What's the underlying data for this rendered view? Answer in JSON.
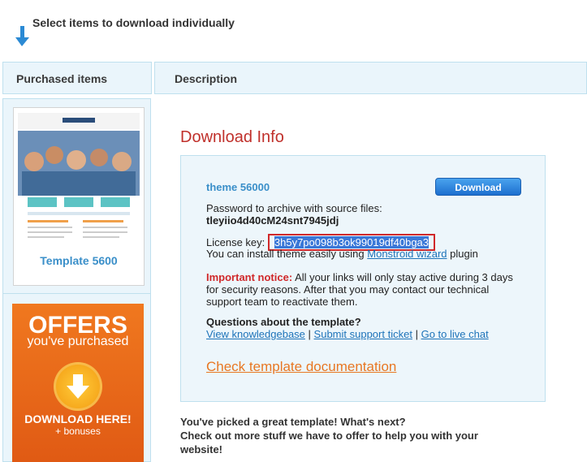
{
  "top": {
    "label": "Select items to download individually"
  },
  "columns": {
    "purchased": "Purchased items",
    "description": "Description"
  },
  "item": {
    "caption": "Template 5600"
  },
  "offers": {
    "title": "OFFERS",
    "subtitle": "you've purchased",
    "download": "DOWNLOAD HERE!",
    "bonus": "+ bonuses"
  },
  "download": {
    "title": "Download Info",
    "theme_name": "theme 56000",
    "button": "Download",
    "password_label": "Password to archive with source files:",
    "password_value": "tleyiio4d40cM24snt7945jdj",
    "license_label": "License key:",
    "license_value": "3h5y7po098b3ok99019df40bga3",
    "install_prefix": "You can install theme easily using",
    "install_link": "Monstroid wizard",
    "install_suffix": "plugin",
    "notice_label": "Important notice:",
    "notice_line1": "All your links will only stay active during 3 days",
    "notice_line2": "for security reasons. After that you may contact our technical",
    "notice_line3": "support team to reactivate them.",
    "questions": "Questions about the template?",
    "link_kb": "View knowledgebase",
    "link_ticket": "Submit support ticket",
    "link_chat": "Go to live chat",
    "check_doc": "Check template documentation"
  },
  "bottom": {
    "line1": "You've picked a great template! What's next?",
    "line2": "Check out more stuff we have to offer to help you with your",
    "line3": "website!"
  }
}
